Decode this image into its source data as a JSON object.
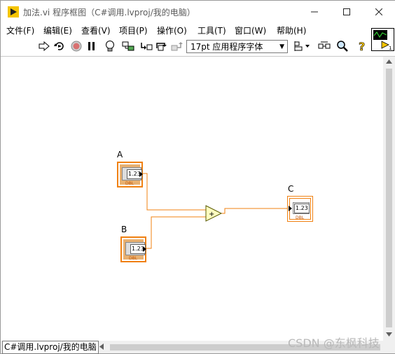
{
  "window": {
    "title": "加法.vi 程序框图（C#调用.lvproj/我的电脑）"
  },
  "menu": {
    "items": [
      "文件(F)",
      "编辑(E)",
      "查看(V)",
      "项目(P)",
      "操作(O)",
      "工具(T)",
      "窗口(W)",
      "帮助(H)"
    ]
  },
  "toolbar": {
    "font_select_value": "17pt 应用程序字体",
    "icons": [
      "run-arrow-icon",
      "run-continuously-icon",
      "abort-icon",
      "pause-icon",
      "highlight-execution-icon",
      "retain-wire-values-icon",
      "step-into-icon",
      "step-over-icon",
      "step-out-icon",
      "align-objects-icon",
      "clean-up-diagram-icon",
      "search-icon",
      "help-icon"
    ]
  },
  "diagram": {
    "controls": [
      {
        "label": "A",
        "value": "1.23",
        "type": "DBL"
      },
      {
        "label": "B",
        "value": "1.23",
        "type": "DBL"
      }
    ],
    "indicator": {
      "label": "C",
      "value": "1.23",
      "type": "DBL"
    },
    "operator": {
      "symbol": "+"
    }
  },
  "status": {
    "project_tab": "C#调用.lvproj/我的电脑"
  },
  "watermark": "CSDN @东枫科技",
  "colors": {
    "wire": "#f08010",
    "terminal_border": "#f08010",
    "add_node_fill": "#ffffc0"
  }
}
